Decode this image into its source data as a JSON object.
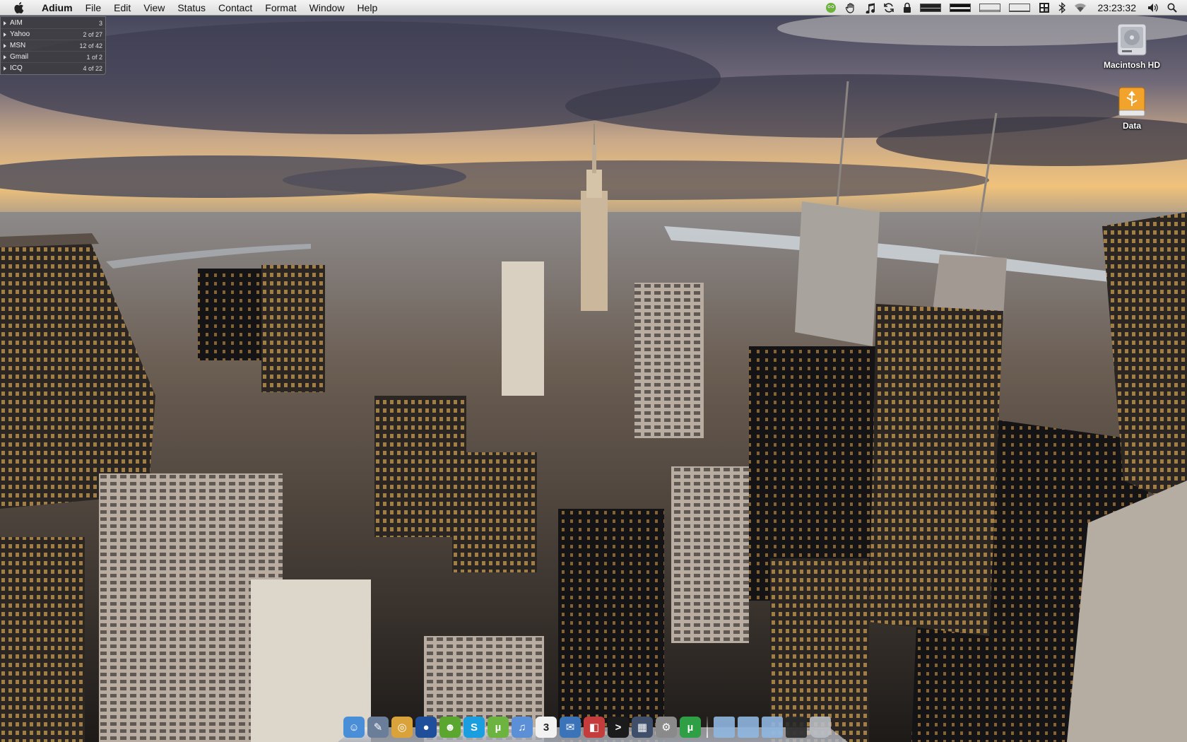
{
  "menubar": {
    "app_name": "Adium",
    "items": [
      "File",
      "Edit",
      "View",
      "Status",
      "Contact",
      "Format",
      "Window",
      "Help"
    ],
    "clock": "23:23:32",
    "extras": [
      "adium-status-icon",
      "hand-icon",
      "music-icon",
      "sync-icon",
      "lock-icon",
      "cpu-meter-icon",
      "memory-meter-icon",
      "network-meter-icon",
      "disk-meter-icon",
      "grid-icon",
      "bluetooth-icon",
      "wifi-icon",
      "volume-icon",
      "spotlight-icon"
    ]
  },
  "adium": {
    "accounts": [
      {
        "name": "AIM",
        "count": "3"
      },
      {
        "name": "Yahoo",
        "count": "2 of 27"
      },
      {
        "name": "MSN",
        "count": "12 of 42"
      },
      {
        "name": "Gmail",
        "count": "1 of 2"
      },
      {
        "name": "ICQ",
        "count": "4 of 22"
      }
    ]
  },
  "desktop": {
    "icons": [
      {
        "label": "Macintosh HD",
        "icon": "hard-drive-icon"
      },
      {
        "label": "Data",
        "icon": "usb-drive-icon"
      }
    ],
    "wallpaper": "new-york-skyline-photo"
  },
  "dock": {
    "apps": [
      {
        "name": "finder",
        "color": "#4a8ed8",
        "glyph": "☺"
      },
      {
        "name": "preview",
        "color": "#6a7e9a",
        "glyph": "✎"
      },
      {
        "name": "safari",
        "color": "#d9a23a",
        "glyph": "◎"
      },
      {
        "name": "globe",
        "color": "#1f4f9a",
        "glyph": "●"
      },
      {
        "name": "adium",
        "color": "#5aa62e",
        "glyph": "☻"
      },
      {
        "name": "skype",
        "color": "#1a9ee0",
        "glyph": "S"
      },
      {
        "name": "utorrent-green",
        "color": "#6cb33f",
        "glyph": "µ"
      },
      {
        "name": "itunes",
        "color": "#5b8fd6",
        "glyph": "♫"
      },
      {
        "name": "ical",
        "color": "#f2f2f2",
        "glyph": "3"
      },
      {
        "name": "mail",
        "color": "#3a73b8",
        "glyph": "✉"
      },
      {
        "name": "photo-tool",
        "color": "#c43c3c",
        "glyph": "◧"
      },
      {
        "name": "terminal",
        "color": "#1b1b1b",
        "glyph": ">"
      },
      {
        "name": "dashboard",
        "color": "#3f4f6a",
        "glyph": "▦"
      },
      {
        "name": "system-preferences",
        "color": "#8a8a8a",
        "glyph": "⚙"
      },
      {
        "name": "utorrent",
        "color": "#2e9f45",
        "glyph": "µ"
      }
    ],
    "stacks": [
      {
        "name": "applications-folder",
        "color": "#8fb6e0"
      },
      {
        "name": "documents-folder",
        "color": "#8fb6e0"
      },
      {
        "name": "downloads-folder",
        "color": "#8fb6e0"
      },
      {
        "name": "screen-stack",
        "color": "#2a2a2a"
      },
      {
        "name": "trash",
        "color": "#b8bcc2"
      }
    ]
  }
}
